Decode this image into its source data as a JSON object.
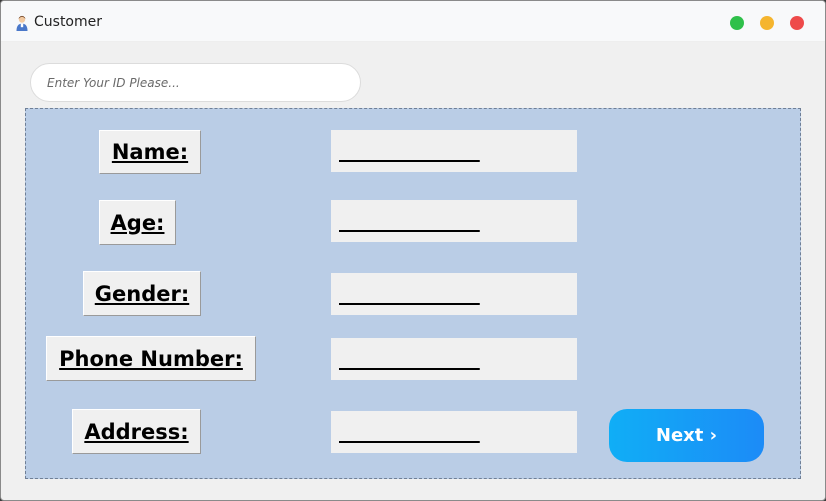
{
  "window": {
    "title": "Customer",
    "app_icon": "customer-person-icon",
    "controls": [
      "maximize-dot",
      "minimize-dot",
      "close-dot"
    ],
    "colors": {
      "green": "#2fc04a",
      "yellow": "#f5b52e",
      "red": "#ee4a4a"
    }
  },
  "search": {
    "placeholder": "Enter Your ID Please..."
  },
  "form": {
    "background": "#bacde6",
    "fields": [
      {
        "label": "Name:",
        "value": "____________"
      },
      {
        "label": "Age:",
        "value": "____________"
      },
      {
        "label": "Gender:",
        "value": "____________"
      },
      {
        "label": "Phone Number:",
        "value": "____________"
      },
      {
        "label": "Address:",
        "value": "____________"
      }
    ]
  },
  "next_button": {
    "label": "Next ›",
    "color": "#1c8bf7"
  }
}
